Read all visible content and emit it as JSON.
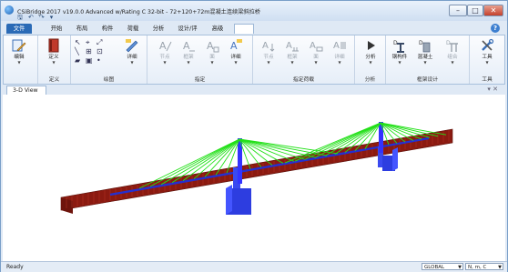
{
  "window": {
    "title": "CSiBridge 2017 v19.0.0 Advanced w/Rating C 32-bit - 72+120+72m混凝土连续梁斜拉桥",
    "controls": {
      "minimize": "–",
      "maximize": "□",
      "close": "✕"
    }
  },
  "qat": {
    "save": "🖫",
    "undo": "↶",
    "redo": "↷",
    "more": "▾"
  },
  "tabs": [
    {
      "label": "文件"
    },
    {
      "label": "开始"
    },
    {
      "label": "布局"
    },
    {
      "label": "构件"
    },
    {
      "label": "荷载"
    },
    {
      "label": "分析"
    },
    {
      "label": "设计/评价"
    },
    {
      "label": "高级"
    }
  ],
  "help_label": "?",
  "ribbon": {
    "groups": [
      {
        "label": "",
        "buttons": [
          {
            "label": "编辑"
          }
        ]
      },
      {
        "label": "定义",
        "buttons": [
          {
            "label": "定义"
          }
        ]
      },
      {
        "label": "绘图",
        "buttons": [
          {
            "label": "详细"
          }
        ]
      },
      {
        "label": "指定",
        "buttons": [
          {
            "label": "节点"
          },
          {
            "label": "框架"
          },
          {
            "label": "面"
          },
          {
            "label": "详细"
          }
        ]
      },
      {
        "label": "指定荷载",
        "buttons": [
          {
            "label": "节点"
          },
          {
            "label": "框架"
          },
          {
            "label": "面"
          },
          {
            "label": "详细"
          }
        ]
      },
      {
        "label": "分析",
        "buttons": [
          {
            "label": "分析"
          }
        ]
      },
      {
        "label": "框架设计",
        "buttons": [
          {
            "label": "钢构件"
          },
          {
            "label": "混凝土"
          },
          {
            "label": "组合"
          }
        ]
      },
      {
        "label": "工具",
        "buttons": [
          {
            "label": "工具"
          }
        ]
      }
    ]
  },
  "document": {
    "tab_label": "3-D View",
    "close_label": "▾ ✕"
  },
  "status": {
    "text": "Ready",
    "coord_system": "GLOBAL",
    "units": "N, m, C"
  },
  "colors": {
    "deck": "#8b1a10",
    "deck_edge": "#b01c10",
    "beam": "#2430d0",
    "tower": "#3333ff",
    "pier": "#3a4af0",
    "cable": "#22e018"
  }
}
